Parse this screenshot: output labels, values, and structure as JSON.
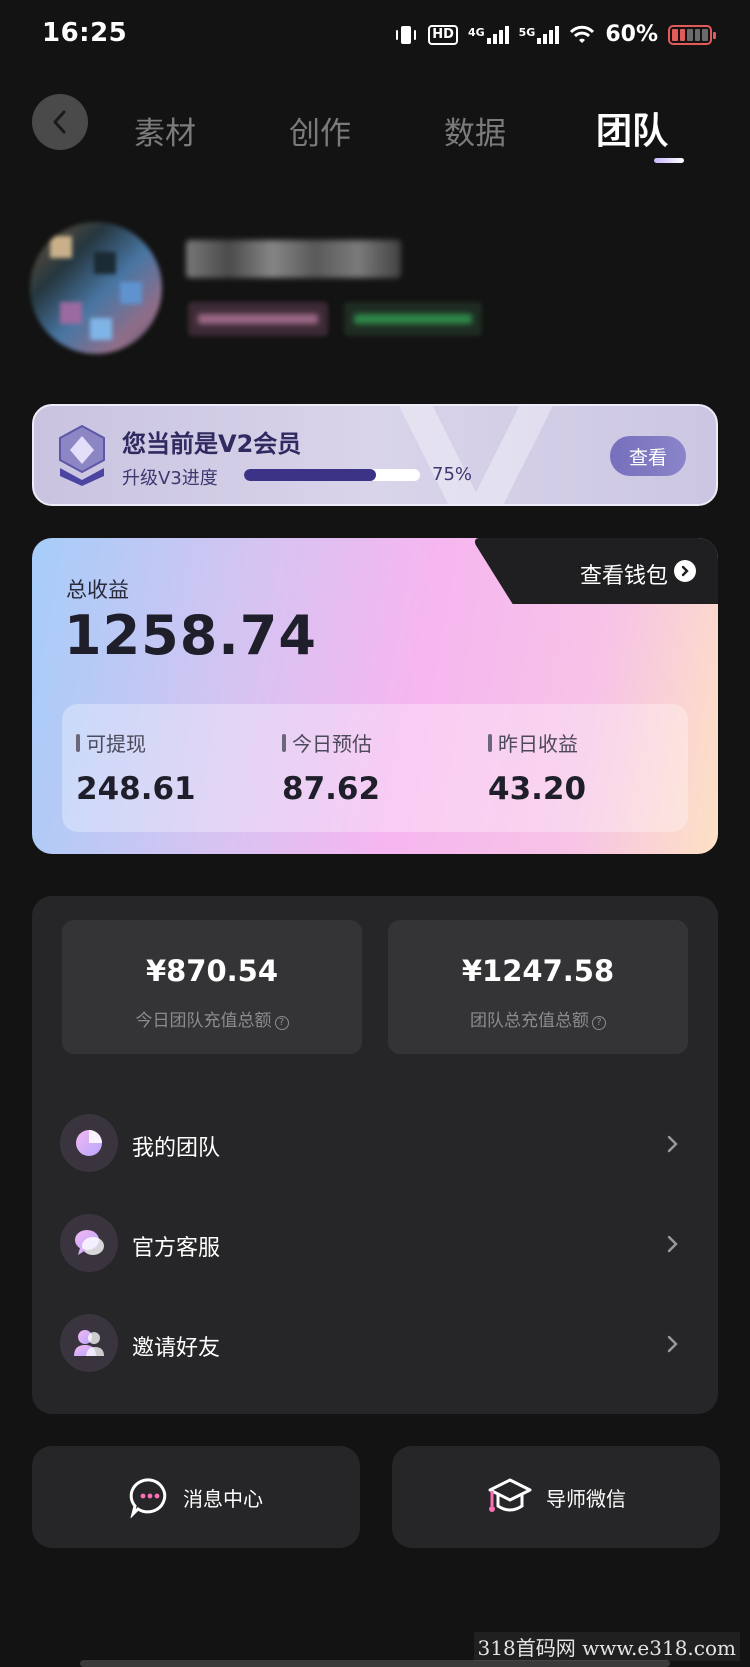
{
  "status_bar": {
    "time": "16:25",
    "hd_label": "HD",
    "net1_label": "4G",
    "net2_label": "5G",
    "battery_percent": "60%",
    "battery_level": 0.6
  },
  "nav": {
    "tabs": [
      {
        "label": "素材"
      },
      {
        "label": "创作"
      },
      {
        "label": "数据"
      },
      {
        "label": "团队"
      }
    ],
    "active_tab": "团队"
  },
  "vip": {
    "title": "您当前是V2会员",
    "progress_label": "升级V3进度",
    "progress_percent": "75%",
    "progress_value": 0.75,
    "view_button": "查看"
  },
  "earnings": {
    "total_label": "总收益",
    "total_value": "1258.74",
    "wallet_link": "查看钱包",
    "items": [
      {
        "label": "可提现",
        "value": "248.61"
      },
      {
        "label": "今日预估",
        "value": "87.62"
      },
      {
        "label": "昨日收益",
        "value": "43.20"
      }
    ]
  },
  "team": {
    "stats": [
      {
        "amount": "¥870.54",
        "label": "今日团队充值总额"
      },
      {
        "amount": "¥1247.58",
        "label": "团队总充值总额"
      }
    ],
    "menu": [
      {
        "label": "我的团队",
        "icon": "pie-chart-icon"
      },
      {
        "label": "官方客服",
        "icon": "chat-bubbles-icon"
      },
      {
        "label": "邀请好友",
        "icon": "users-icon"
      }
    ]
  },
  "bottom_buttons": [
    {
      "label": "消息中心",
      "icon": "message-icon"
    },
    {
      "label": "导师微信",
      "icon": "graduation-cap-icon"
    }
  ],
  "watermark": "318首码网 www.e318.com",
  "colors": {
    "background": "#131313",
    "panel": "#262628",
    "vip_accent": "#3a3386",
    "active_tab": "#ffffff",
    "inactive_tab": "#7b7b7b"
  }
}
